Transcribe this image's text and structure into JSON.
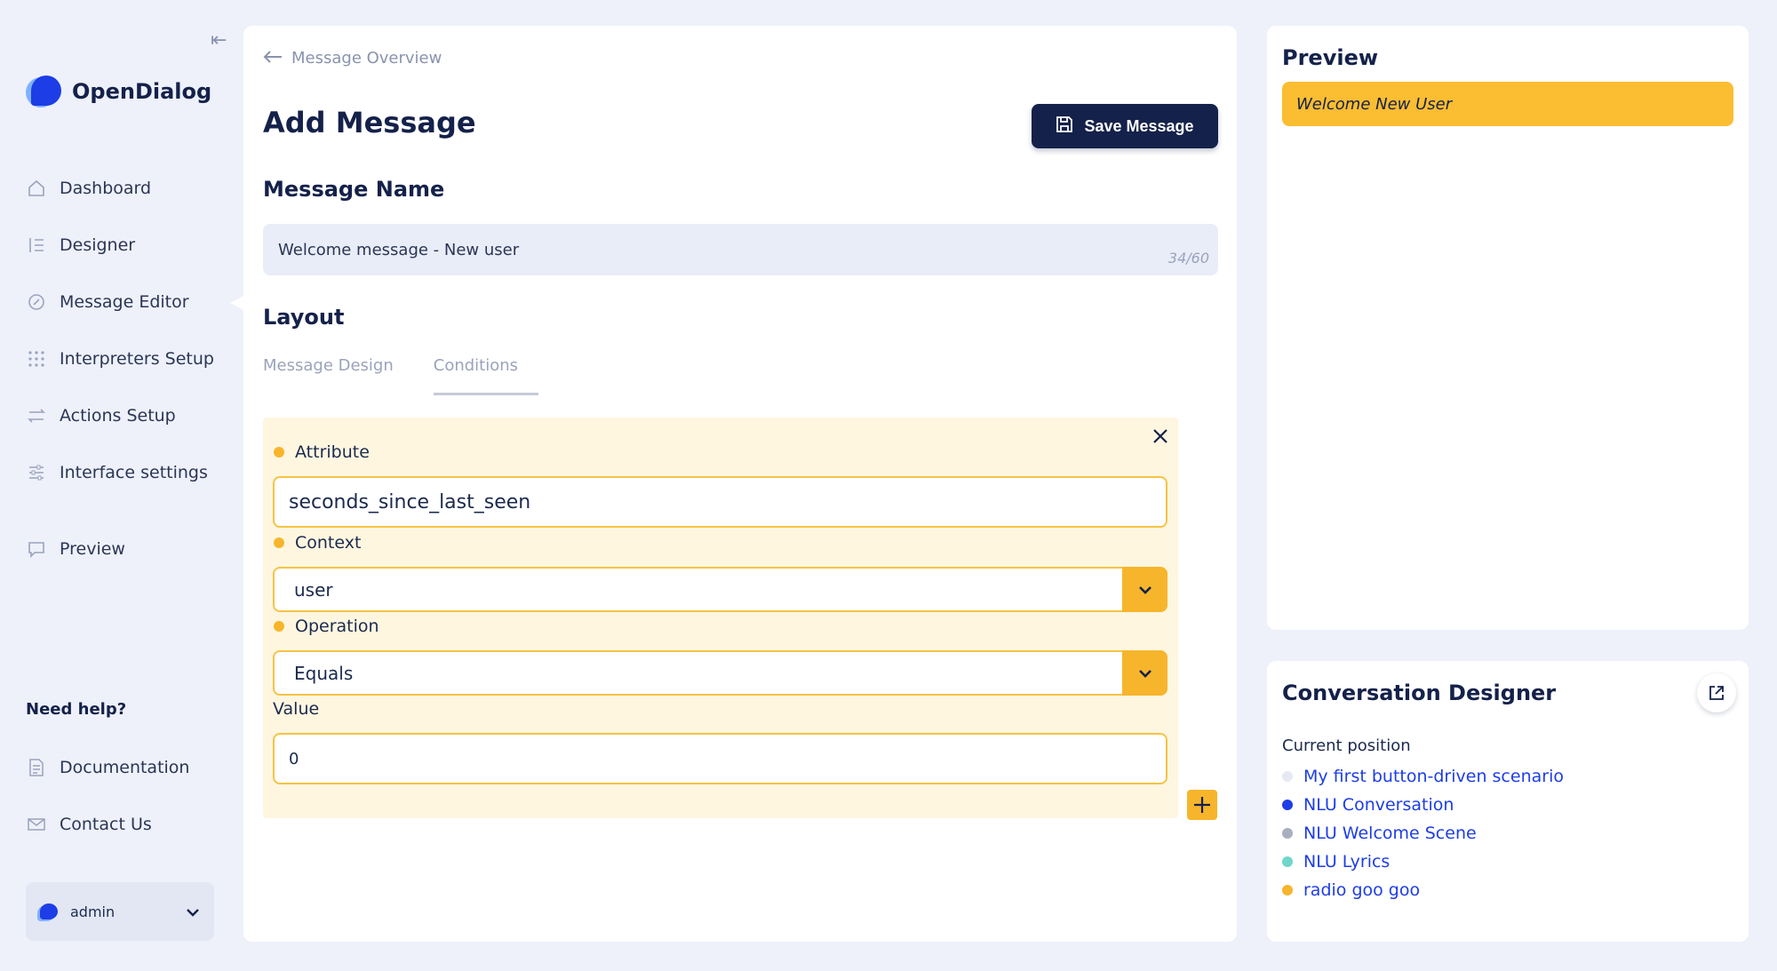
{
  "sidebar": {
    "brand": "OpenDialog",
    "items": [
      {
        "label": "Dashboard",
        "icon": "home-icon"
      },
      {
        "label": "Designer",
        "icon": "designer-icon"
      },
      {
        "label": "Message Editor",
        "icon": "message-editor-icon"
      },
      {
        "label": "Interpreters Setup",
        "icon": "interpreters-icon"
      },
      {
        "label": "Actions Setup",
        "icon": "actions-icon"
      },
      {
        "label": "Interface settings",
        "icon": "sliders-icon"
      },
      {
        "label": "Preview",
        "icon": "preview-icon"
      }
    ],
    "help_title": "Need help?",
    "help_items": [
      {
        "label": "Documentation",
        "icon": "document-icon"
      },
      {
        "label": "Contact Us",
        "icon": "mail-icon"
      }
    ],
    "user": "admin"
  },
  "main": {
    "back_label": "Message Overview",
    "title": "Add Message",
    "save_label": "Save Message",
    "message_name_heading": "Message Name",
    "message_name_value": "Welcome message - New user",
    "message_name_count": "34/60",
    "layout_heading": "Layout",
    "tabs": [
      {
        "label": "Message Design",
        "active": false
      },
      {
        "label": "Conditions",
        "active": true
      }
    ],
    "condition": {
      "attribute_label": "Attribute",
      "attribute_value": "seconds_since_last_seen",
      "context_label": "Context",
      "context_value": "user",
      "operation_label": "Operation",
      "operation_value": "Equals",
      "value_label": "Value",
      "value_value": "0"
    }
  },
  "preview": {
    "heading": "Preview",
    "bubble": "Welcome New User"
  },
  "conversation_designer": {
    "heading": "Conversation Designer",
    "subheading": "Current position",
    "items": [
      {
        "label": "My first button-driven scenario",
        "color": "#e6e9f2"
      },
      {
        "label": "NLU Conversation",
        "color": "#1d3de6"
      },
      {
        "label": "NLU Welcome Scene",
        "color": "#a9aec0"
      },
      {
        "label": "NLU Lyrics",
        "color": "#6fd6c9"
      },
      {
        "label": "radio goo goo",
        "color": "#f7b52c"
      }
    ]
  },
  "colors": {
    "brand_navy": "#14214a",
    "accent_yellow": "#f7b52c",
    "link_blue": "#1d3de6",
    "background": "#eef1fa"
  }
}
